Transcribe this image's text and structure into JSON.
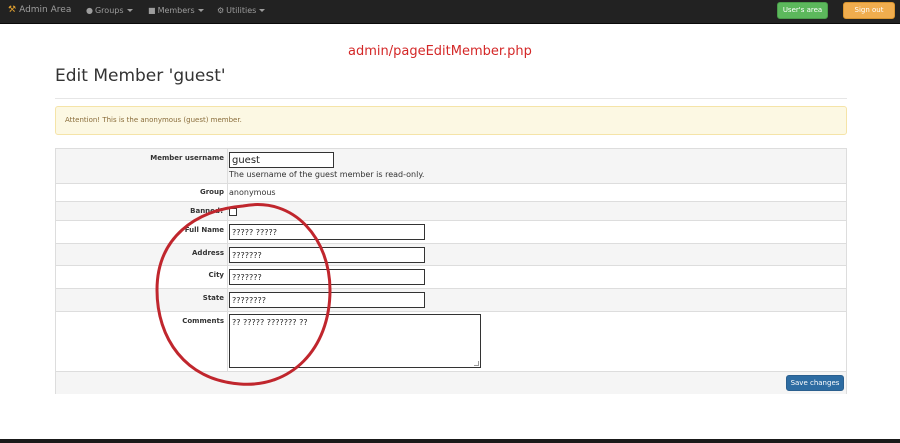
{
  "navbar": {
    "brand": "Admin Area",
    "items": [
      {
        "label": "Groups",
        "icon": "globe-icon"
      },
      {
        "label": "Members",
        "icon": "user-icon"
      },
      {
        "label": "Utilities",
        "icon": "gear-icon"
      }
    ],
    "users_area_label": "User's area",
    "sign_out_label": "Sign out"
  },
  "url_caption": "admin/pageEditMember.php",
  "page_title": "Edit Member 'guest'",
  "alert": "Attention! This is the anonymous (guest) member.",
  "form": {
    "username": {
      "label": "Member username",
      "value": "guest",
      "hint": "The username of the guest member is read-only."
    },
    "group": {
      "label": "Group",
      "value": "anonymous"
    },
    "banned": {
      "label": "Banned?",
      "checked": false
    },
    "full_name": {
      "label": "Full Name",
      "value": "????? ?????"
    },
    "address": {
      "label": "Address",
      "value": "???????"
    },
    "city": {
      "label": "City",
      "value": "???????"
    },
    "state": {
      "label": "State",
      "value": "????????"
    },
    "comments": {
      "label": "Comments",
      "value": "?? ????? ??????? ??"
    },
    "save_label": "Save changes"
  },
  "colors": {
    "annotation_circle": "#c0262d",
    "caption": "#d42828",
    "save_button": "#2d6ca2",
    "users_area_button": "#5cb85c",
    "sign_out_button": "#f0ad4e"
  }
}
